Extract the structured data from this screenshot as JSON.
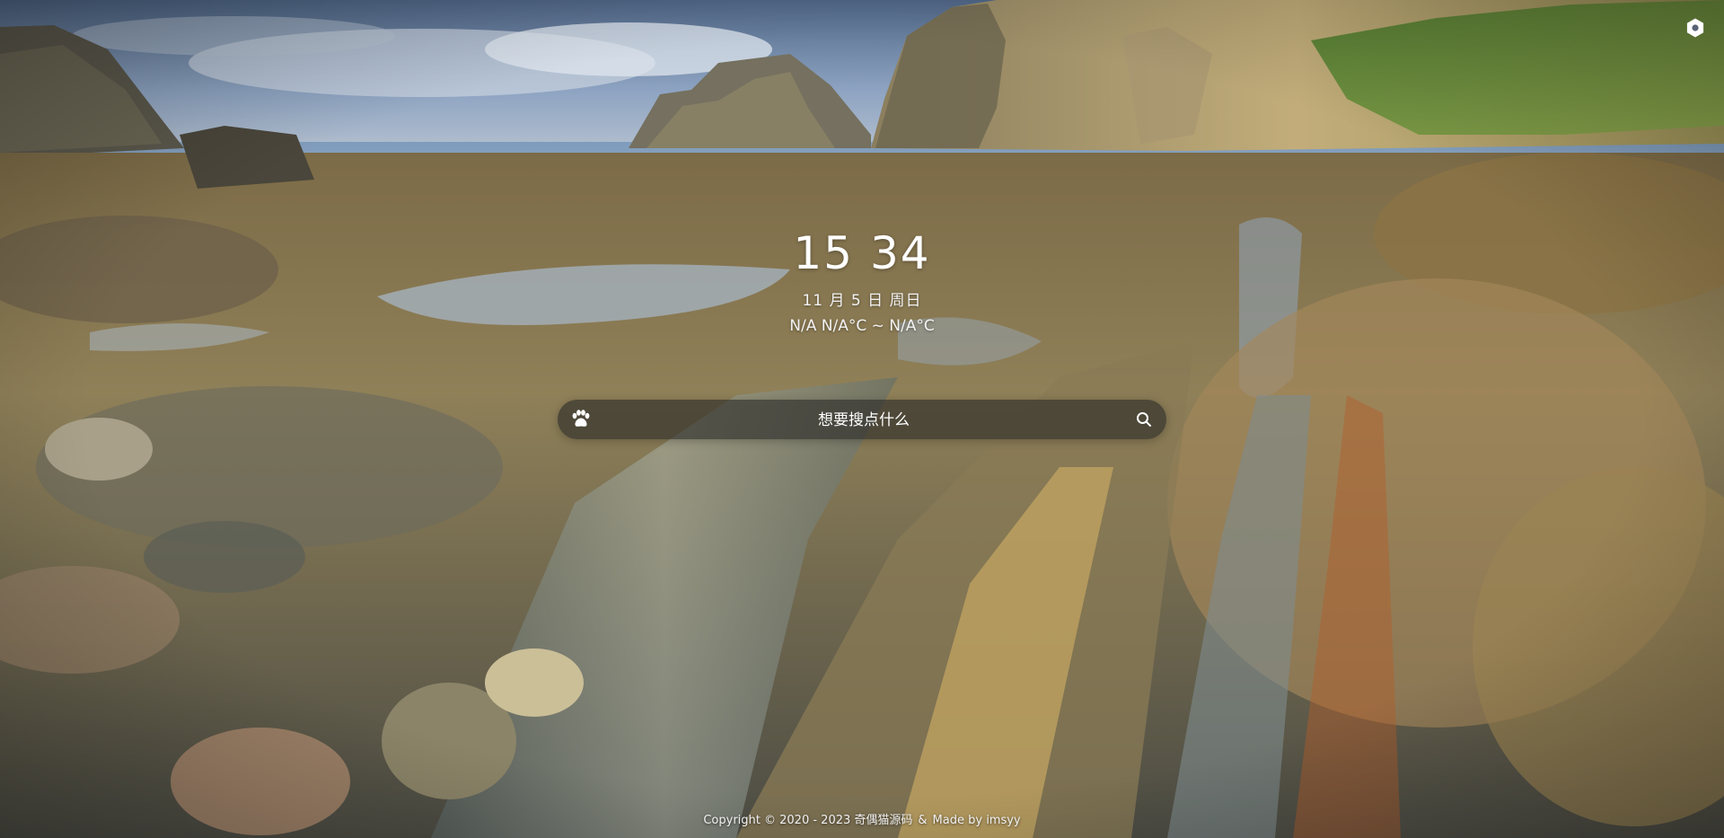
{
  "clock": {
    "hours": "15",
    "minutes": "34"
  },
  "date": {
    "text": "11 月 5 日 周日"
  },
  "weather": {
    "text": "N/A N/A°C ~ N/A°C"
  },
  "search": {
    "placeholder": "想要搜点什么",
    "value": "",
    "engine_icon": "paw-icon",
    "submit_icon": "search-icon"
  },
  "settings": {
    "icon": "gear-icon"
  },
  "footer": {
    "copyright": "Copyright © 2020 - 2023 奇偶猫源码",
    "separator": "&",
    "made_by": "Made by imsyy"
  },
  "colors": {
    "text": "#ffffff",
    "search_bg": "rgba(40,40,38,0.62)",
    "sky": "#8fa5c4",
    "sea": "#86a2c0",
    "rock": "#a48b52"
  }
}
